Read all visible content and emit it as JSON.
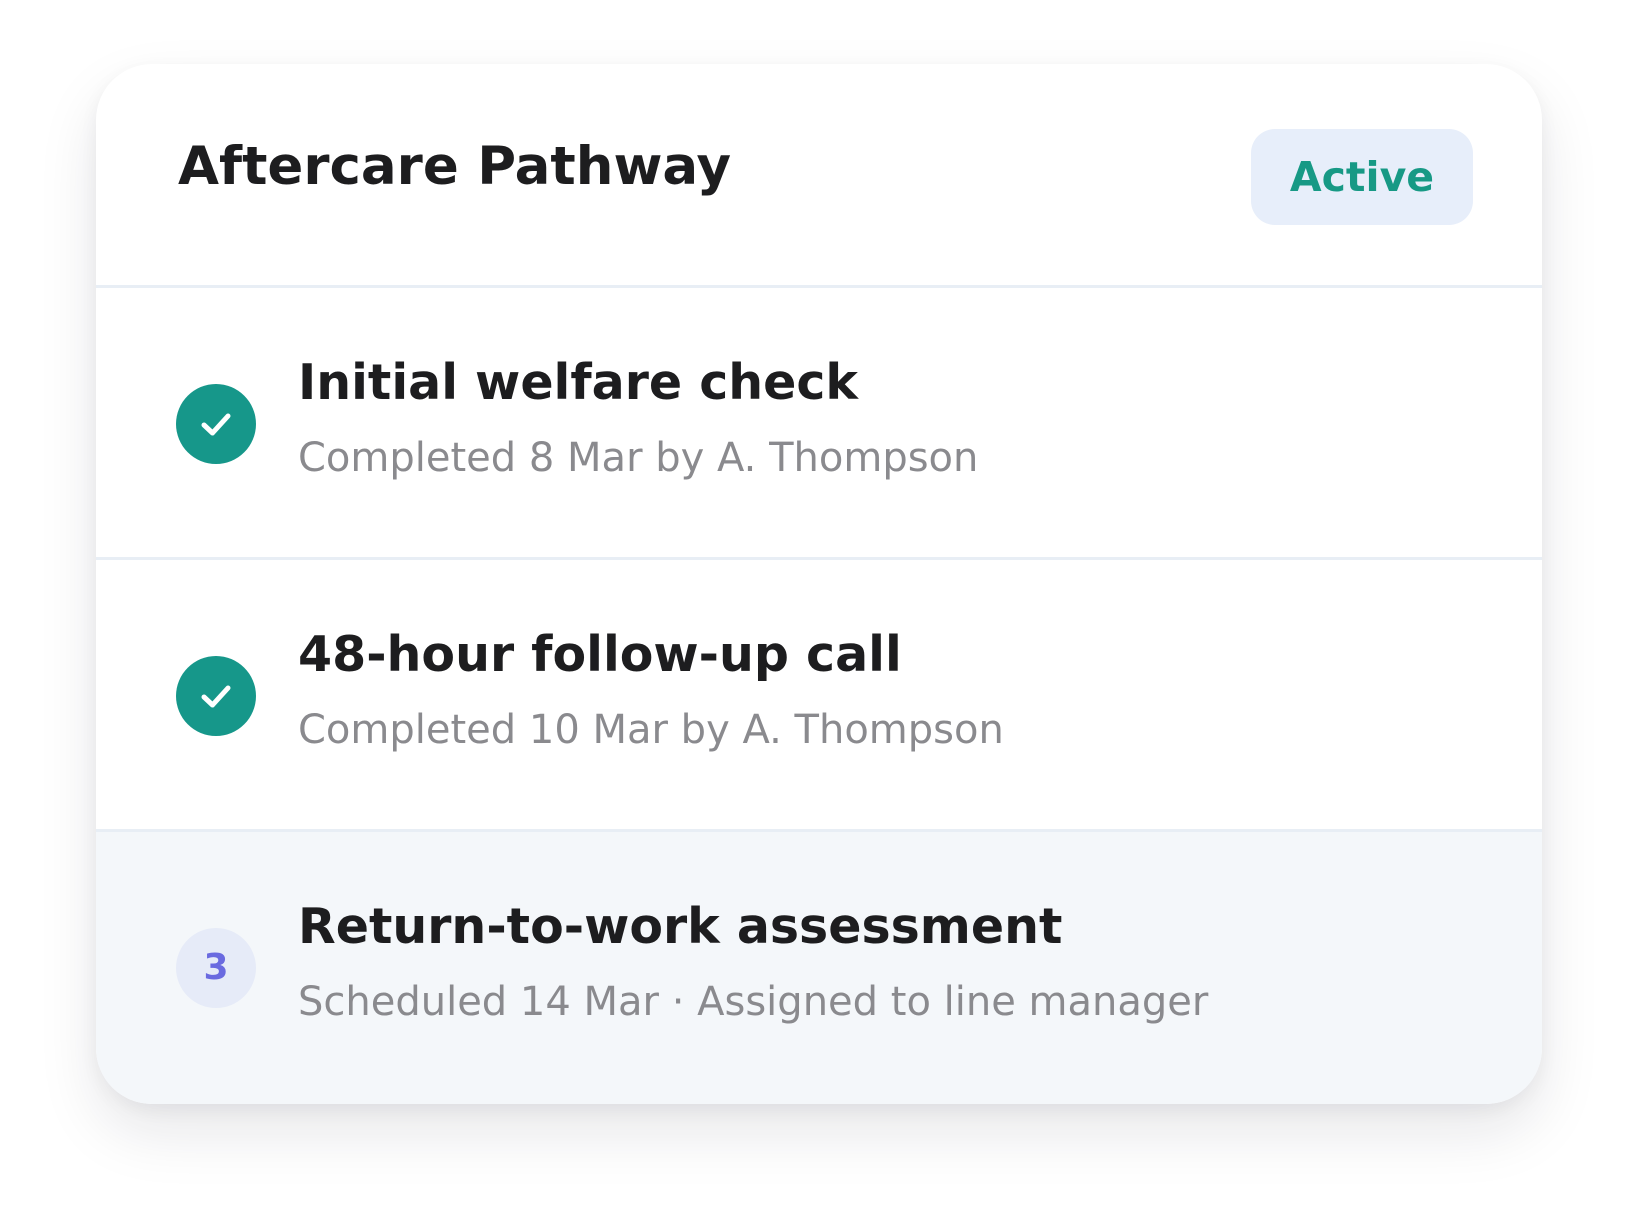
{
  "card": {
    "title": "Aftercare Pathway",
    "status_badge": "Active"
  },
  "steps": [
    {
      "title": "Initial welfare check",
      "subtitle": "Completed 8 Mar by A. Thompson",
      "status": "completed",
      "icon": "check-icon"
    },
    {
      "title": "48-hour follow-up call",
      "subtitle": "Completed 10 Mar by A. Thompson",
      "status": "completed",
      "icon": "check-icon"
    },
    {
      "title": "Return-to-work assessment",
      "subtitle": "Scheduled 14 Mar · Assigned to line manager",
      "status": "scheduled",
      "number": "3"
    }
  ],
  "colors": {
    "accent_teal": "#16978a",
    "badge_background": "#e7eefa",
    "badge_text": "#179985",
    "pending_circle": "#e6ebf8",
    "pending_number": "#6a6ae0",
    "title_text": "#1d1d1f",
    "muted_text": "#8a8a8e",
    "highlight_row": "#f4f7fa"
  }
}
